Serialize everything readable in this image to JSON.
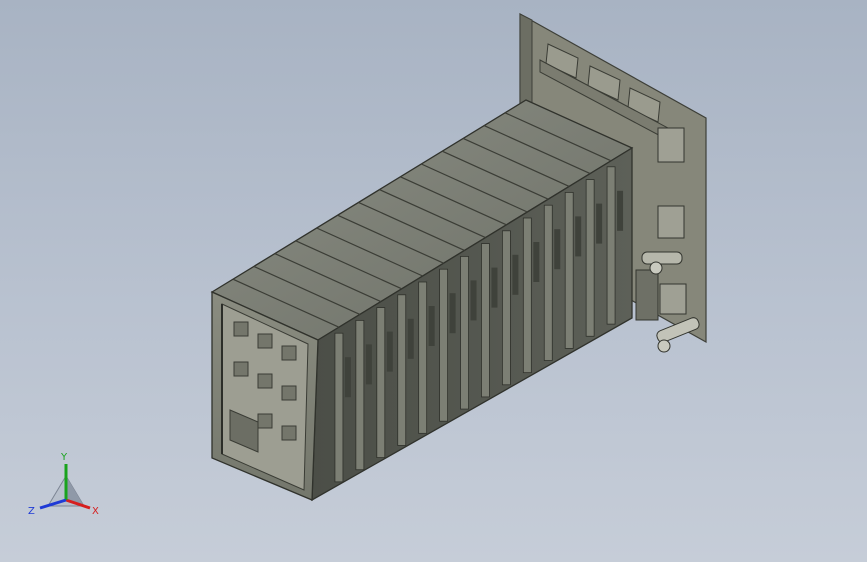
{
  "viewport": {
    "background_top": "#a8b3c3",
    "background_bottom": "#c6cdd8"
  },
  "model": {
    "body_color": "#6f726a",
    "frame_color": "#5e6257",
    "plate_color": "#7e7f73",
    "module_count": 14
  },
  "triad": {
    "x_label": "X",
    "y_label": "Y",
    "z_label": "Z",
    "x_color": "#d61f1f",
    "y_color": "#19a31d",
    "z_color": "#1f3ad6"
  }
}
